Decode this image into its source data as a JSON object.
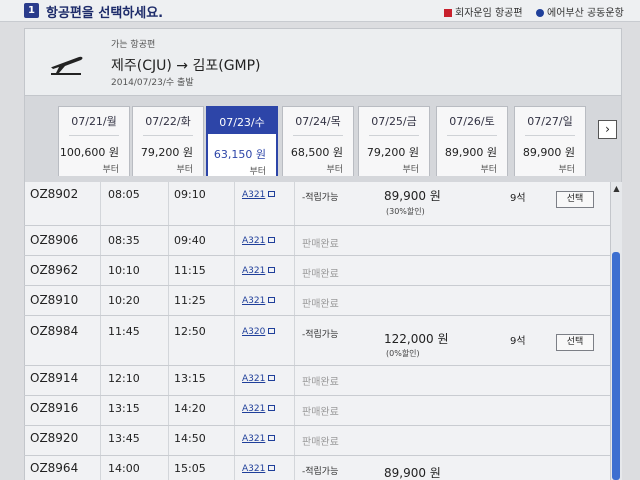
{
  "header": {
    "step_number": "1",
    "title": "항공편을 선택하세요.",
    "legend": [
      {
        "label": "회자운임 항공편",
        "color": "#c8202c"
      },
      {
        "label": "에어부산 공동운항",
        "color": "#1f3f9a"
      }
    ]
  },
  "route": {
    "subtitle": "가는 항공편",
    "title": "제주(CJU) → 김포(GMP)",
    "date": "2014/07/23/수 출발",
    "icon": "plane-icon"
  },
  "date_tabs": [
    {
      "date": "07/21/월",
      "price": "100,600 원",
      "from": "부터",
      "active": false
    },
    {
      "date": "07/22/화",
      "price": "79,200 원",
      "from": "부터",
      "active": false
    },
    {
      "date": "07/23/수",
      "price": "63,150 원",
      "from": "부터",
      "active": true
    },
    {
      "date": "07/24/목",
      "price": "68,500 원",
      "from": "부터",
      "active": false
    },
    {
      "date": "07/25/금",
      "price": "79,200 원",
      "from": "부터",
      "active": false
    },
    {
      "date": "07/26/토",
      "price": "89,900 원",
      "from": "부터",
      "active": false
    },
    {
      "date": "07/27/일",
      "price": "89,900 원",
      "from": "부터",
      "active": false
    }
  ],
  "next_label": "›",
  "flights": [
    {
      "flight": "OZ8902",
      "dep": "08:05",
      "arr": "09:10",
      "aircraft": "A321",
      "status": "-적립가능",
      "price": "89,900 원",
      "discount": "(30%할인)",
      "seats": "9석",
      "action": "선택",
      "sold_out": false
    },
    {
      "flight": "OZ8906",
      "dep": "08:35",
      "arr": "09:40",
      "aircraft": "A321",
      "status": "판매완료",
      "price": "",
      "discount": "",
      "seats": "",
      "action": "",
      "sold_out": true
    },
    {
      "flight": "OZ8962",
      "dep": "10:10",
      "arr": "11:15",
      "aircraft": "A321",
      "status": "판매완료",
      "price": "",
      "discount": "",
      "seats": "",
      "action": "",
      "sold_out": true
    },
    {
      "flight": "OZ8910",
      "dep": "10:20",
      "arr": "11:25",
      "aircraft": "A321",
      "status": "판매완료",
      "price": "",
      "discount": "",
      "seats": "",
      "action": "",
      "sold_out": true
    },
    {
      "flight": "OZ8984",
      "dep": "11:45",
      "arr": "12:50",
      "aircraft": "A320",
      "status": "-적립가능",
      "price": "122,000 원",
      "discount": "(0%할인)",
      "seats": "9석",
      "action": "선택",
      "sold_out": false
    },
    {
      "flight": "OZ8914",
      "dep": "12:10",
      "arr": "13:15",
      "aircraft": "A321",
      "status": "판매완료",
      "price": "",
      "discount": "",
      "seats": "",
      "action": "",
      "sold_out": true
    },
    {
      "flight": "OZ8916",
      "dep": "13:15",
      "arr": "14:20",
      "aircraft": "A321",
      "status": "판매완료",
      "price": "",
      "discount": "",
      "seats": "",
      "action": "",
      "sold_out": true
    },
    {
      "flight": "OZ8920",
      "dep": "13:45",
      "arr": "14:50",
      "aircraft": "A321",
      "status": "판매완료",
      "price": "",
      "discount": "",
      "seats": "",
      "action": "",
      "sold_out": true
    },
    {
      "flight": "OZ8964",
      "dep": "14:00",
      "arr": "15:05",
      "aircraft": "A321",
      "status": "-적립가능",
      "price": "89,900 원",
      "discount": "",
      "seats": "",
      "action": "",
      "sold_out": false
    }
  ]
}
